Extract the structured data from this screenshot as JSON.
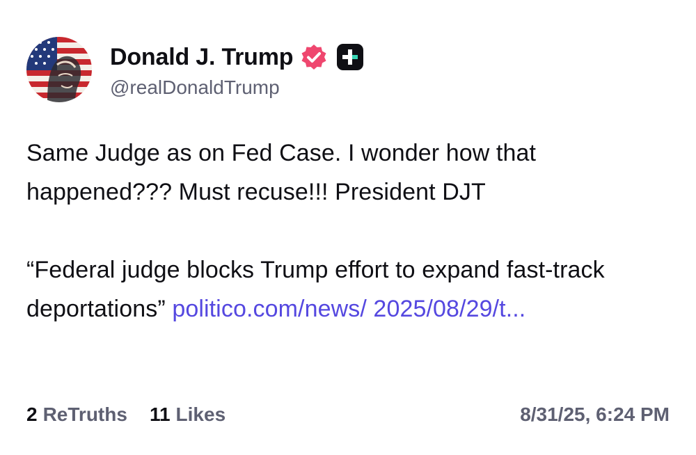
{
  "author": {
    "display_name": "Donald J. Trump",
    "handle": "@realDonaldTrump",
    "avatar_icon": "flag-portrait-avatar",
    "verified_icon": "verified-badge-icon",
    "verified_color": "#ef476f",
    "plus_icon": "plus-badge-icon"
  },
  "post": {
    "paragraph_1": "Same Judge as on Fed Case. I wonder how that happened??? Must recuse!!! President DJT",
    "quote_text": "“Federal judge blocks Trump effort to expand fast-track deportations” ",
    "link_text": "politico.com/news/ 2025/08/29/t...",
    "link_color": "#5548e0"
  },
  "stats": {
    "retruths_count": "2",
    "retruths_label": "ReTruths",
    "likes_count": "11",
    "likes_label": "Likes",
    "timestamp": "8/31/25, 6:24 PM"
  }
}
